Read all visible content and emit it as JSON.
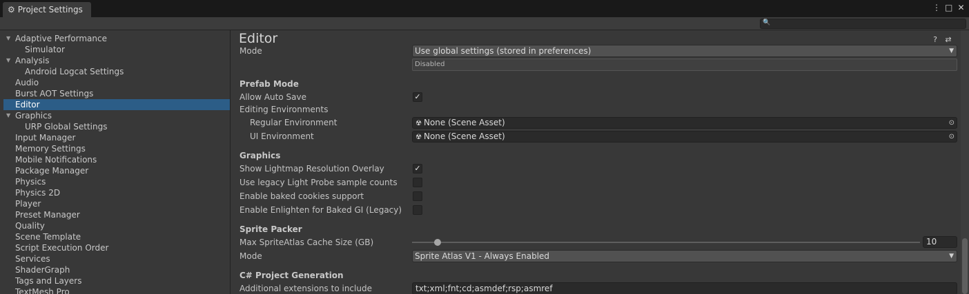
{
  "window": {
    "tab_title": "Project Settings",
    "tab_icon": "gear-icon",
    "controls": [
      "more-icon",
      "maximize-icon",
      "close-icon"
    ]
  },
  "search": {
    "placeholder": "",
    "icon": "search-icon"
  },
  "sidebar": {
    "selected": "Editor",
    "items": [
      {
        "label": "Adaptive Performance",
        "expandable": true,
        "indent": 0
      },
      {
        "label": "Simulator",
        "expandable": false,
        "indent": 1
      },
      {
        "label": "Analysis",
        "expandable": true,
        "indent": 0
      },
      {
        "label": "Android Logcat Settings",
        "expandable": false,
        "indent": 1
      },
      {
        "label": "Audio",
        "expandable": false,
        "indent": 0
      },
      {
        "label": "Burst AOT Settings",
        "expandable": false,
        "indent": 0
      },
      {
        "label": "Editor",
        "expandable": false,
        "indent": 0
      },
      {
        "label": "Graphics",
        "expandable": true,
        "indent": 0
      },
      {
        "label": "URP Global Settings",
        "expandable": false,
        "indent": 1
      },
      {
        "label": "Input Manager",
        "expandable": false,
        "indent": 0
      },
      {
        "label": "Memory Settings",
        "expandable": false,
        "indent": 0
      },
      {
        "label": "Mobile Notifications",
        "expandable": false,
        "indent": 0
      },
      {
        "label": "Package Manager",
        "expandable": false,
        "indent": 0
      },
      {
        "label": "Physics",
        "expandable": false,
        "indent": 0
      },
      {
        "label": "Physics 2D",
        "expandable": false,
        "indent": 0
      },
      {
        "label": "Player",
        "expandable": false,
        "indent": 0
      },
      {
        "label": "Preset Manager",
        "expandable": false,
        "indent": 0
      },
      {
        "label": "Quality",
        "expandable": false,
        "indent": 0
      },
      {
        "label": "Scene Template",
        "expandable": false,
        "indent": 0
      },
      {
        "label": "Script Execution Order",
        "expandable": false,
        "indent": 0
      },
      {
        "label": "Services",
        "expandable": false,
        "indent": 0
      },
      {
        "label": "ShaderGraph",
        "expandable": false,
        "indent": 0
      },
      {
        "label": "Tags and Layers",
        "expandable": false,
        "indent": 0
      },
      {
        "label": "TextMesh Pro",
        "expandable": false,
        "indent": 0
      }
    ]
  },
  "main": {
    "title": "Editor",
    "header_icons": [
      "help-icon",
      "preset-icon",
      "more-icon"
    ],
    "mode": {
      "label": "Mode",
      "value": "Use global settings (stored in preferences)",
      "status": "Disabled"
    },
    "prefab_mode": {
      "heading": "Prefab Mode",
      "allow_auto_save_label": "Allow Auto Save",
      "allow_auto_save": true,
      "editing_environments_label": "Editing Environments",
      "regular_environment_label": "Regular Environment",
      "regular_environment_value": "None (Scene Asset)",
      "ui_environment_label": "UI Environment",
      "ui_environment_value": "None (Scene Asset)"
    },
    "graphics": {
      "heading": "Graphics",
      "show_lightmap_label": "Show Lightmap Resolution Overlay",
      "show_lightmap": true,
      "legacy_light_probe_label": "Use legacy Light Probe sample counts",
      "legacy_light_probe": false,
      "baked_cookies_label": "Enable baked cookies support",
      "baked_cookies": false,
      "enlighten_label": "Enable Enlighten for Baked GI (Legacy)",
      "enlighten": false
    },
    "sprite_packer": {
      "heading": "Sprite Packer",
      "cache_size_label": "Max SpriteAtlas Cache Size (GB)",
      "cache_size_value": "10",
      "cache_size_fraction": 0.05,
      "mode_label": "Mode",
      "mode_value": "Sprite Atlas V1 - Always Enabled"
    },
    "csharp": {
      "heading": "C# Project Generation",
      "extensions_label": "Additional extensions to include",
      "extensions_value": "txt;xml;fnt;cd;asmdef;rsp;asmref"
    }
  }
}
